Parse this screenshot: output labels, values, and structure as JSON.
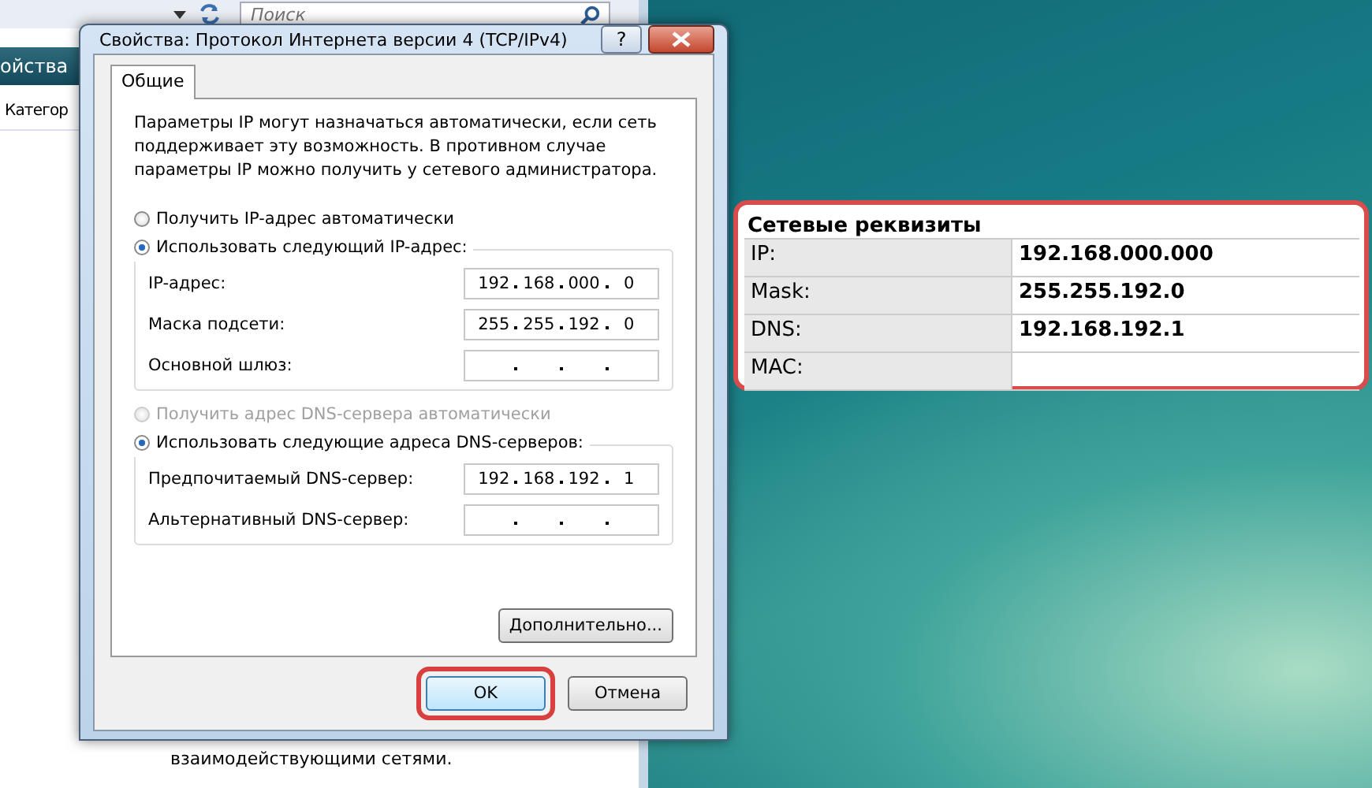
{
  "background_window": {
    "search": {
      "placeholder": "Поиск"
    },
    "toolbar_label": "ойства",
    "column_header": "Категор",
    "body_text": "взаимодействующими сетями."
  },
  "dialog": {
    "title": "Свойства: Протокол Интернета версии 4 (TCP/IPv4)",
    "help_button": "?",
    "tabs": [
      {
        "label": "Общие",
        "selected": true
      }
    ],
    "description": "Параметры IP могут назначаться автоматически, если сеть поддерживает эту возможность. В противном случае параметры IP можно получить у сетевого администратора.",
    "sections": [
      {
        "auto_option": {
          "label": "Получить IP-адрес автоматически",
          "selected": false,
          "disabled": false
        },
        "manual_option": {
          "label": "Использовать следующий IP-адрес:",
          "selected": true,
          "disabled": false
        },
        "fields": [
          {
            "label": "IP-адрес:",
            "octets": [
              "192",
              "168",
              "000",
              "0"
            ]
          },
          {
            "label": "Маска подсети:",
            "octets": [
              "255",
              "255",
              "192",
              "0"
            ]
          },
          {
            "label": "Основной шлюз:"
          }
        ]
      },
      {
        "auto_option": {
          "label": "Получить адрес DNS-сервера автоматически",
          "selected": false,
          "disabled": true
        },
        "manual_option": {
          "label": "Использовать следующие адреса DNS-серверов:",
          "selected": true,
          "disabled": false
        },
        "fields": [
          {
            "label": "Предпочитаемый DNS-сервер:",
            "octets": [
              "192",
              "168",
              "192",
              "1"
            ]
          },
          {
            "label": "Альтернативный DNS-сервер:"
          }
        ]
      }
    ],
    "advanced_button": "Дополнительно...",
    "buttons": [
      {
        "label": "OK",
        "highlighted": true
      },
      {
        "label": "Отмена",
        "highlighted": false
      }
    ]
  },
  "info_card": {
    "title": "Сетевые реквизиты",
    "rows": [
      {
        "label": "IP:",
        "value": "192.168.000.000"
      },
      {
        "label": "Mask:",
        "value": "255.255.192.0"
      },
      {
        "label": "DNS:",
        "value": "192.168.192.1"
      },
      {
        "label": "MAC:"
      }
    ]
  }
}
